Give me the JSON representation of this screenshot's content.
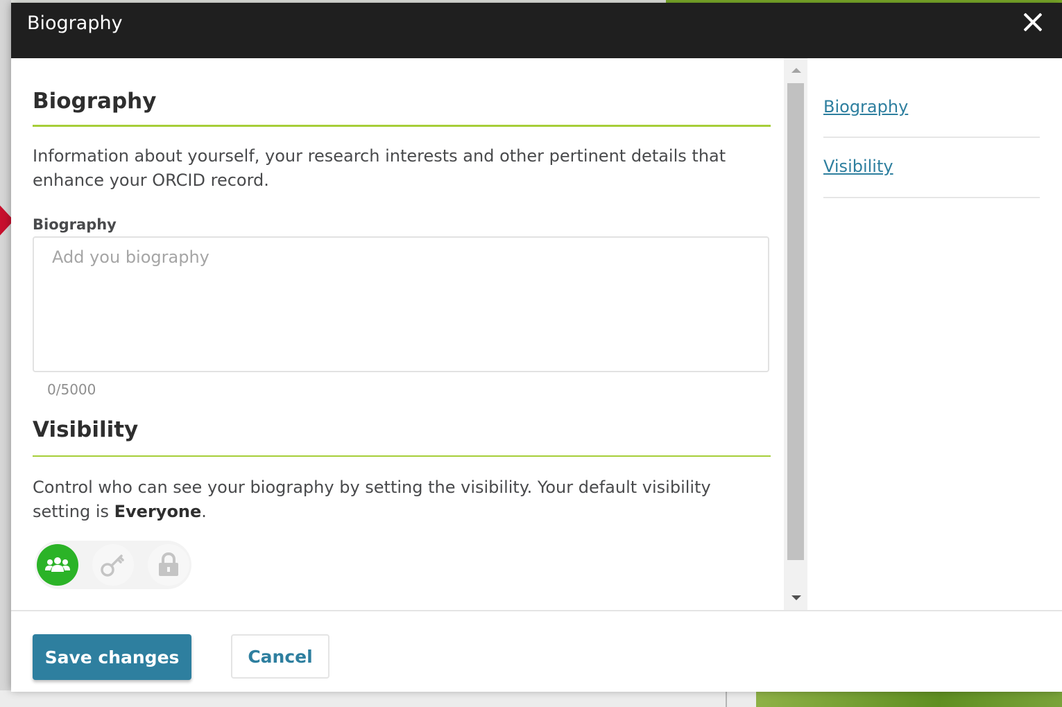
{
  "modal": {
    "title": "Biography",
    "close_icon": "close-icon"
  },
  "biography_section": {
    "heading": "Biography",
    "description": "Information about yourself, your research interests and other pertinent details that enhance your ORCID record.",
    "field_label": "Biography",
    "field_placeholder": "Add you biography",
    "field_value": "",
    "char_count": "0/5000"
  },
  "visibility_section": {
    "heading": "Visibility",
    "description_prefix": "Control who can see your biography by setting the visibility. Your default visibility setting is ",
    "description_default": "Everyone",
    "description_suffix": ".",
    "options": [
      {
        "name": "Everyone",
        "icon": "users-icon",
        "selected": true
      },
      {
        "name": "Trusted parties",
        "icon": "key-icon",
        "selected": false
      },
      {
        "name": "Only me",
        "icon": "lock-icon",
        "selected": false
      }
    ]
  },
  "side_nav": {
    "items": [
      {
        "label": "Biography"
      },
      {
        "label": "Visibility"
      }
    ]
  },
  "footer": {
    "save_label": "Save changes",
    "cancel_label": "Cancel"
  },
  "colors": {
    "header_bg": "#1f1f1f",
    "accent_green": "#a6ce39",
    "selected_green": "#2bb327",
    "link_blue": "#2e7f9f"
  }
}
